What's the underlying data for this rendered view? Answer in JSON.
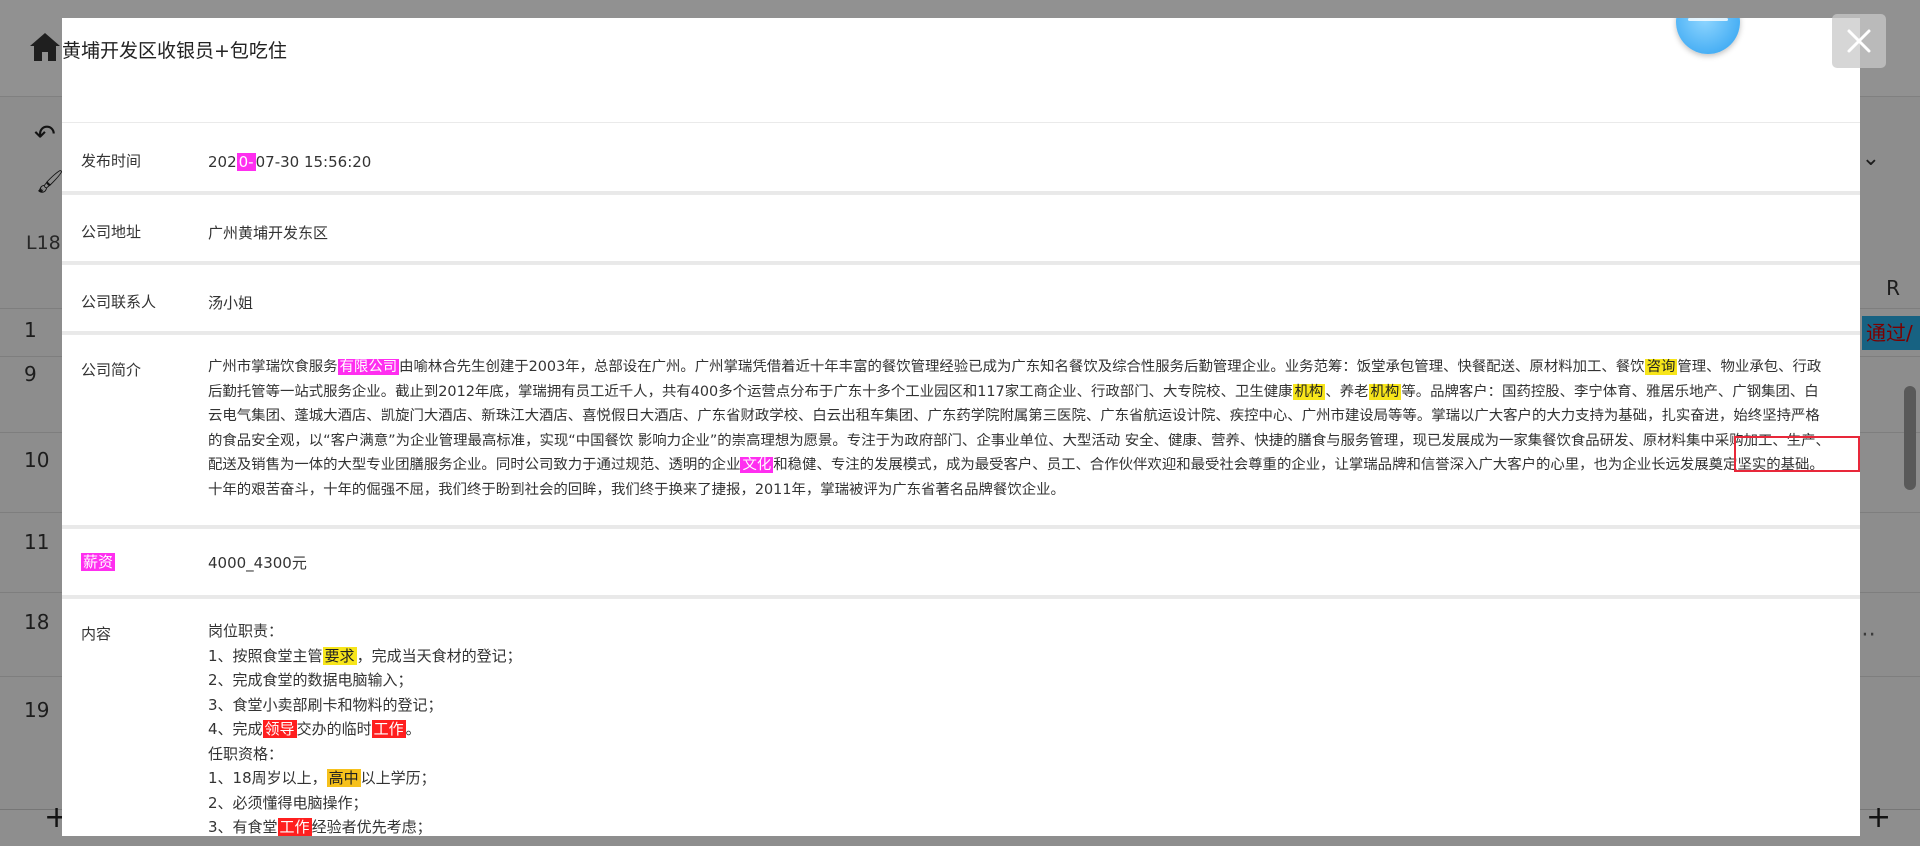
{
  "background": {
    "row_numbers": [
      "1",
      "9",
      "10",
      "11",
      "18",
      "19"
    ],
    "left_label": "L18",
    "right_label": "R",
    "right_badge": "通过/",
    "plus_left": "+",
    "plus_right": "+"
  },
  "modal": {
    "title": "黄埔开发区收银员+包吃住",
    "publish_time": {
      "label": "发布时间",
      "value_pre": "202",
      "value_hl": "0-",
      "value_post": "07-30 15:56:20"
    },
    "company_address": {
      "label": "公司地址",
      "value": "广州黄埔开发东区"
    },
    "company_contact": {
      "label": "公司联系人",
      "value": "汤小姐"
    },
    "company_intro": {
      "label": "公司简介",
      "t1": "广州市掌瑞饮食服务",
      "h1": "有限公司",
      "t2": "由喻林合先生创建于2003年，总部设在广州。广州掌瑞凭借着近十年丰富的餐饮管理经验已成为广东知名餐饮及综合性服务后勤管理企业。业务范筹：饭堂承包管理、快餐配送、原材料加工、餐饮",
      "h2": "咨询",
      "t3": "管理、物业承包、行政后勤托管等一站式服务企业。截止到2012年底，掌瑞拥有员工近千人，共有400多个运营点分布于广东十多个工业园区和117家工商企业、行政部门、大专院校、卫生健康",
      "h3": "机构",
      "t4": "、养老",
      "h4": "机构",
      "t5": "等。品牌客户：国药控股、李宁体育、雅居乐地产、广钢集团、白云电气集团、蓬城大酒店、凯旋门大酒店、新珠江大酒店、喜悦假日大酒店、广东省财政学校、白云出租车集团、广东药学院附属第三医院、广东省航运设计院、疾控中心、广州市建设局等等。掌瑞以广大客户的大力支持为基础，扎实奋进，始终坚持严格的食品安全观，以“客户满意”为企业管理最高标准，实现“中国餐饮 影响力企业”的崇高理想为愿景。专注于为政府部门、企事业单位、大型活动 安全、健康、营养、快捷的膳食与服务管理，现已发展成为一家集餐饮食品研发、原材料集中采购加工、生产、配送及销售为一体的大型专业团膳服务企业。同时公司致力于通过规范、透明的企业",
      "h5": "文化",
      "t6": "和稳健、专注的发展模式，成为最受客户、员工、合作伙伴欢迎和最受社会尊重的企业，让掌瑞品牌和信誉深入广大客户的心里，也为企业长远发展奠定坚实的基础。十年的艰苦奋斗，十年的倔强不屈，我们终于盼到社会的回眸，我们终于换来了捷报，2011年，掌瑞被评为广东省著名品牌餐饮企业。"
    },
    "salary": {
      "label": "薪资",
      "value": "4000_4300元"
    },
    "content": {
      "label": "内容",
      "l1": "岗位职责：",
      "l2_pre": "1、按照食堂主管",
      "l2_hl": "要求",
      "l2_post": "，完成当天食材的登记；",
      "l3": "2、完成食堂的数据电脑输入；",
      "l4": "3、食堂小卖部刷卡和物料的登记；",
      "l5_pre": "4、完成",
      "l5_hl1": "领导",
      "l5_mid": "交办的临时",
      "l5_hl2": "工作",
      "l5_post": "。",
      "l6": "任职资格：",
      "l7_pre": "1、18周岁以上，",
      "l7_hl": "高中",
      "l7_post": "以上学历；",
      "l8": "2、必须懂得电脑操作；",
      "l9_pre": "3、有食堂",
      "l9_hl": "工作",
      "l9_post": "经验者优先考虑；"
    }
  },
  "colors": {
    "highlight_magenta": "#ff2ef0",
    "highlight_yellow": "#f7e51a",
    "highlight_red": "#ff1f1f",
    "highlight_orange": "#f6c11c",
    "annotation_box": "#e8283a"
  }
}
